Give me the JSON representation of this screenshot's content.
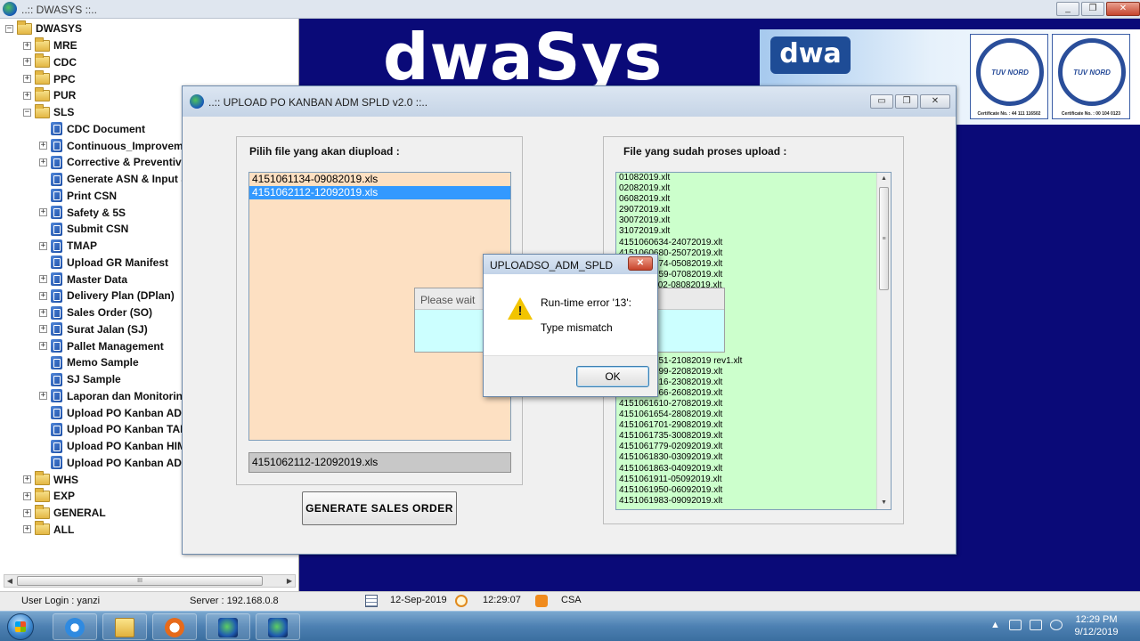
{
  "main_window": {
    "title": "..:: DWASYS ::..",
    "buttons": [
      "_",
      "❐",
      "✕"
    ]
  },
  "tree": {
    "root": "DWASYS",
    "nodes": [
      {
        "label": "MRE",
        "kind": "folder",
        "expander": "+"
      },
      {
        "label": "CDC",
        "kind": "folder",
        "expander": "+"
      },
      {
        "label": "PPC",
        "kind": "folder",
        "expander": "+"
      },
      {
        "label": "PUR",
        "kind": "folder",
        "expander": "+"
      },
      {
        "label": "SLS",
        "kind": "folder",
        "expander": "−"
      },
      {
        "label": "CDC Document",
        "kind": "doc",
        "expander": ""
      },
      {
        "label": "Continuous_Improvemen",
        "kind": "doc",
        "expander": "+"
      },
      {
        "label": "Corrective & Preventive",
        "kind": "doc",
        "expander": "+"
      },
      {
        "label": "Generate ASN & Input SI",
        "kind": "doc",
        "expander": ""
      },
      {
        "label": "Print CSN",
        "kind": "doc",
        "expander": ""
      },
      {
        "label": "Safety & 5S",
        "kind": "doc",
        "expander": "+"
      },
      {
        "label": "Submit CSN",
        "kind": "doc",
        "expander": ""
      },
      {
        "label": "TMAP",
        "kind": "doc",
        "expander": "+"
      },
      {
        "label": "Upload GR Manifest",
        "kind": "doc",
        "expander": ""
      },
      {
        "label": "Master Data",
        "kind": "doc",
        "expander": "+"
      },
      {
        "label": "Delivery Plan (DPlan)",
        "kind": "doc",
        "expander": "+"
      },
      {
        "label": "Sales Order (SO)",
        "kind": "doc",
        "expander": "+"
      },
      {
        "label": "Surat Jalan (SJ)",
        "kind": "doc",
        "expander": "+"
      },
      {
        "label": "Pallet Management",
        "kind": "doc",
        "expander": "+"
      },
      {
        "label": "Memo Sample",
        "kind": "doc",
        "expander": ""
      },
      {
        "label": "SJ Sample",
        "kind": "doc",
        "expander": ""
      },
      {
        "label": "Laporan dan Monitoring",
        "kind": "doc",
        "expander": "+"
      },
      {
        "label": "Upload PO Kanban ADP (",
        "kind": "doc",
        "expander": ""
      },
      {
        "label": "Upload PO Kanban TAM",
        "kind": "doc",
        "expander": ""
      },
      {
        "label": "Upload PO Kanban HIM (",
        "kind": "doc",
        "expander": ""
      },
      {
        "label": "Upload PO Kanban ADM",
        "kind": "doc",
        "expander": ""
      },
      {
        "label": "WHS",
        "kind": "folder",
        "expander": "+"
      },
      {
        "label": "EXP",
        "kind": "folder",
        "expander": "+"
      },
      {
        "label": "GENERAL",
        "kind": "folder",
        "expander": "+"
      },
      {
        "label": "ALL",
        "kind": "folder",
        "expander": "+"
      }
    ],
    "scroll_thumb_grip": "III"
  },
  "banner": {
    "logo_text": "dwaSys",
    "badge_text": "dwa",
    "certs": [
      {
        "ring_text": "TUV NORD",
        "number": "Certificate No. : 44 111 116502"
      },
      {
        "ring_text": "TUV NORD",
        "number": "Certificate No. : 00 104 0123"
      }
    ]
  },
  "upload_dialog": {
    "title": "..:: UPLOAD PO KANBAN ADM SPLD v2.0 ::..",
    "buttons": [
      "▭",
      "❐",
      "✕"
    ],
    "left_label": "Pilih file yang akan diupload   :",
    "left_files": [
      {
        "name": "4151061134-09082019.xls",
        "selected": false
      },
      {
        "name": "4151062112-12092019.xls",
        "selected": true
      }
    ],
    "selected_path": "4151062112-12092019.xls",
    "generate_button": "GENERATE SALES ORDER",
    "right_label": "File yang sudah proses upload   :",
    "right_files": [
      "01082019.xlt",
      "02082019.xlt",
      "06082019.xlt",
      "29072019.xlt",
      "30072019.xlt",
      "31072019.xlt",
      "4151060634-24072019.xlt",
      "4151060680-25072019.xlt",
      "4151060774-05082019.xlt",
      "4151060759-07082019.xlt",
      "4151061102-08082019.xlt",
      "",
      "",
      "",
      "",
      "",
      "4151061176-20082019.xlt",
      "4151061251-21082019 rev1.xlt",
      "4151061399-22082019.xlt",
      "4151061416-23082019.xlt",
      "4151061566-26082019.xlt",
      "4151061610-27082019.xlt",
      "4151061654-28082019.xlt",
      "4151061701-29082019.xlt",
      "4151061735-30082019.xlt",
      "4151061779-02092019.xlt",
      "4151061830-03092019.xlt",
      "4151061863-04092019.xlt",
      "4151061911-05092019.xlt",
      "4151061950-06092019.xlt",
      "4151061983-09092019.xlt"
    ],
    "scroll_grip": "≡"
  },
  "wait_box": {
    "title": "Please wait"
  },
  "error_dialog": {
    "title": "UPLOADSO_ADM_SPLD",
    "message_line1": "Run-time error '13':",
    "message_line2": "Type mismatch",
    "ok_label": "OK",
    "close_label": "✕"
  },
  "statusbar": {
    "user": "User Login : yanzi",
    "server": "Server : 192.168.0.8",
    "date": "12-Sep-2019",
    "time": "12:29:07",
    "dept": "CSA"
  },
  "taskbar": {
    "tray_arrow": "▲",
    "clock_time": "12:29 PM",
    "clock_date": "9/12/2019"
  },
  "colors": {
    "desktop_bg": "#0a0a78",
    "left_list_bg": "#fde0c2",
    "right_list_bg": "#ccffcc",
    "wait_bg": "#ccffff",
    "selection": "#3399ff"
  }
}
